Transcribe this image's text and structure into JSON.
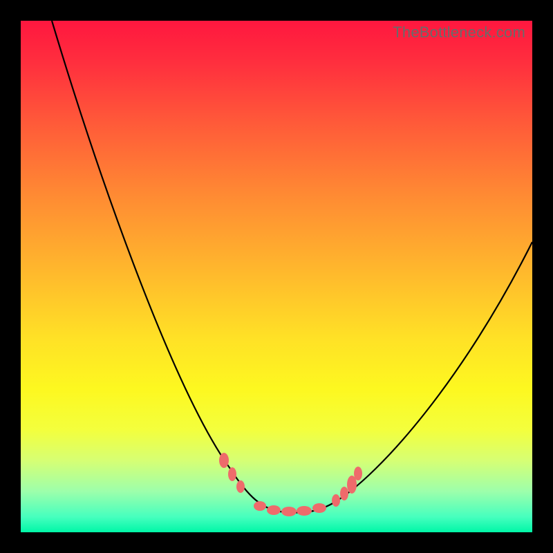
{
  "watermark": "TheBottleneck.com",
  "chart_data": {
    "type": "line",
    "title": "",
    "xlabel": "",
    "ylabel": "",
    "xlim": [
      0,
      100
    ],
    "ylim": [
      0,
      100
    ],
    "gradient_bands": [
      {
        "label": "red",
        "approx_y_pct": 0
      },
      {
        "label": "orange",
        "approx_y_pct": 35
      },
      {
        "label": "yellow",
        "approx_y_pct": 65
      },
      {
        "label": "green",
        "approx_y_pct": 100
      }
    ],
    "series": [
      {
        "name": "bottleneck-curve",
        "x": [
          6,
          10,
          14,
          18,
          22,
          26,
          30,
          34,
          38,
          42,
          45,
          48,
          51,
          54,
          57,
          60,
          64,
          68,
          72,
          76,
          80,
          84,
          88,
          92,
          96,
          100
        ],
        "y": [
          100,
          91,
          82,
          73,
          64,
          55,
          47,
          39,
          31,
          23,
          16,
          10,
          6,
          4,
          4,
          5,
          8,
          12,
          17,
          23,
          29,
          35,
          41,
          47,
          52,
          57
        ]
      }
    ],
    "annotations": {
      "flat_minimum_markers_x": [
        46,
        49,
        52,
        55,
        58,
        61
      ],
      "left_slope_markers_x": [
        41,
        43,
        45
      ],
      "right_slope_markers_x": [
        62,
        63,
        65
      ]
    }
  }
}
